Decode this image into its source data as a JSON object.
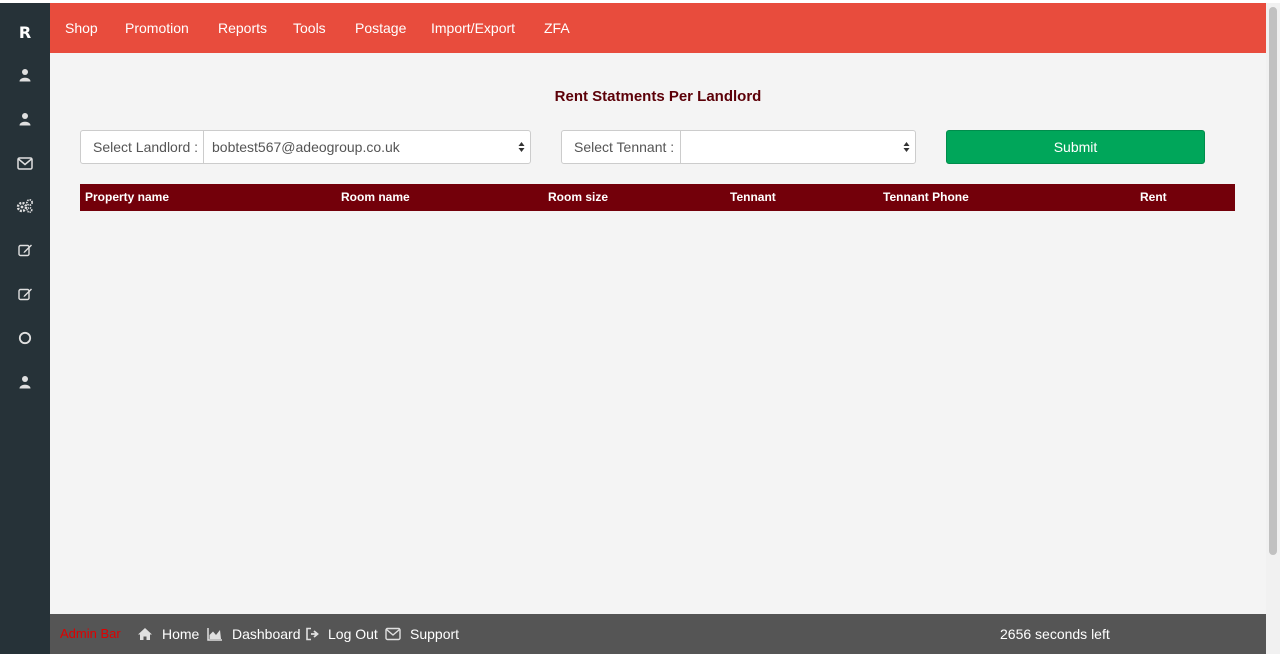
{
  "sidebar": {
    "logo": "R",
    "items": [
      {
        "icon": "user-icon"
      },
      {
        "icon": "user-icon"
      },
      {
        "icon": "envelope-icon"
      },
      {
        "icon": "gears-icon"
      },
      {
        "icon": "edit-icon"
      },
      {
        "icon": "edit-icon"
      },
      {
        "icon": "circle-icon"
      },
      {
        "icon": "user-icon"
      }
    ]
  },
  "topnav": {
    "items": [
      "Shop",
      "Promotion",
      "Reports",
      "Tools",
      "Postage",
      "Import/Export",
      "ZFA"
    ]
  },
  "main": {
    "title": "Rent Statments Per Landlord",
    "landlord_label": "Select Landlord :",
    "landlord_value": "bobtest567@adeogroup.co.uk",
    "tenant_label": "Select Tennant :",
    "tenant_value": "",
    "submit_label": "Submit",
    "table": {
      "columns": [
        "Property name",
        "Room name",
        "Room size",
        "Tennant",
        "Tennant Phone",
        "Rent"
      ],
      "rows": []
    }
  },
  "footer": {
    "admin_label": "Admin Bar",
    "links": [
      {
        "icon": "home-icon",
        "label": "Home"
      },
      {
        "icon": "area-chart-icon",
        "label": "Dashboard"
      },
      {
        "icon": "sign-out-icon",
        "label": "Log Out"
      },
      {
        "icon": "envelope-icon",
        "label": "Support"
      }
    ],
    "timer": "2656 seconds left"
  },
  "colors": {
    "sidebar": "#263238",
    "topnav": "#e84c3d",
    "table_header": "#73000a",
    "submit": "#00a65a",
    "title": "#5c0008",
    "footer": "#555555"
  }
}
